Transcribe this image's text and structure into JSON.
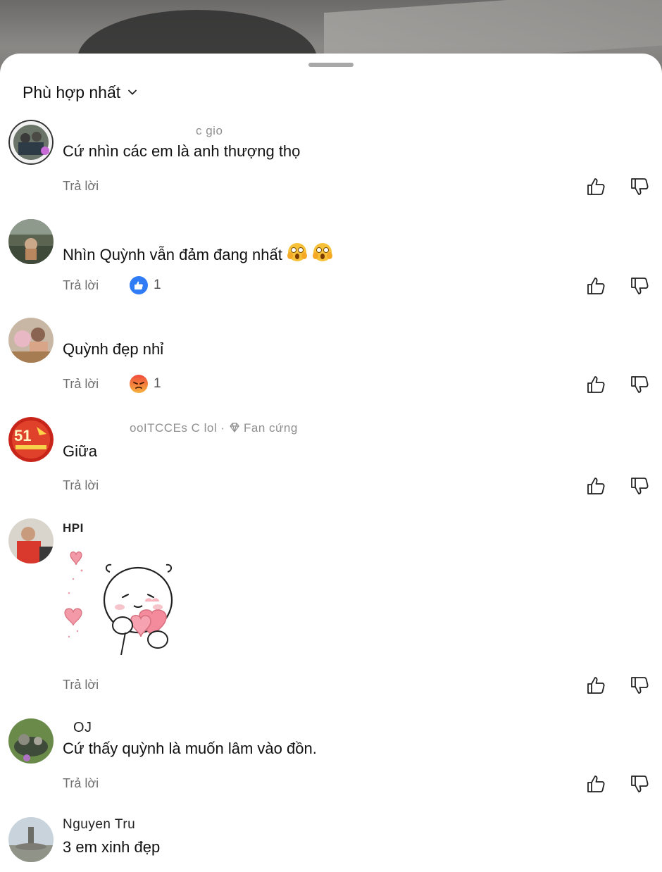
{
  "sort": {
    "label": "Phù hợp nhất"
  },
  "comments": [
    {
      "username": "c gio",
      "text": "Cứ nhìn các em là anh thượng thọ",
      "reply": "Trả lời"
    },
    {
      "username": "",
      "text": "Nhìn Quỳnh vẫn đảm đang nhất",
      "reply": "Trả lời",
      "reaction": "like",
      "reaction_count": "1"
    },
    {
      "username": "",
      "text": "Quỳnh đẹp nhỉ",
      "reply": "Trả lời",
      "reaction": "angry",
      "reaction_count": "1"
    },
    {
      "username": "ooITCCEs  C lol ·",
      "badge": "Fan cứng",
      "text": "Giữa",
      "reply": "Trả lời"
    },
    {
      "username": "HPI",
      "text": "",
      "sticker": "bear-hearts-sticker",
      "reply": "Trả lời"
    },
    {
      "username": "OJ",
      "text": "Cứ thấy quỳnh là muốn lâm vào đồn.",
      "reply": "Trả lời"
    },
    {
      "username": "Nguyen Tru",
      "text": "3 em xinh đẹp"
    }
  ],
  "colors": {
    "like_blue": "#2f7cf6",
    "angry_orange": "#ef6a43",
    "sheet_bg": "#ffffff",
    "muted_text": "#8f8f8f"
  },
  "icons": [
    "chevron-down-icon",
    "thumb-up-icon",
    "thumb-down-icon",
    "diamond-icon",
    "like-reaction-icon",
    "angry-reaction-icon",
    "shocked-face-emoji"
  ]
}
